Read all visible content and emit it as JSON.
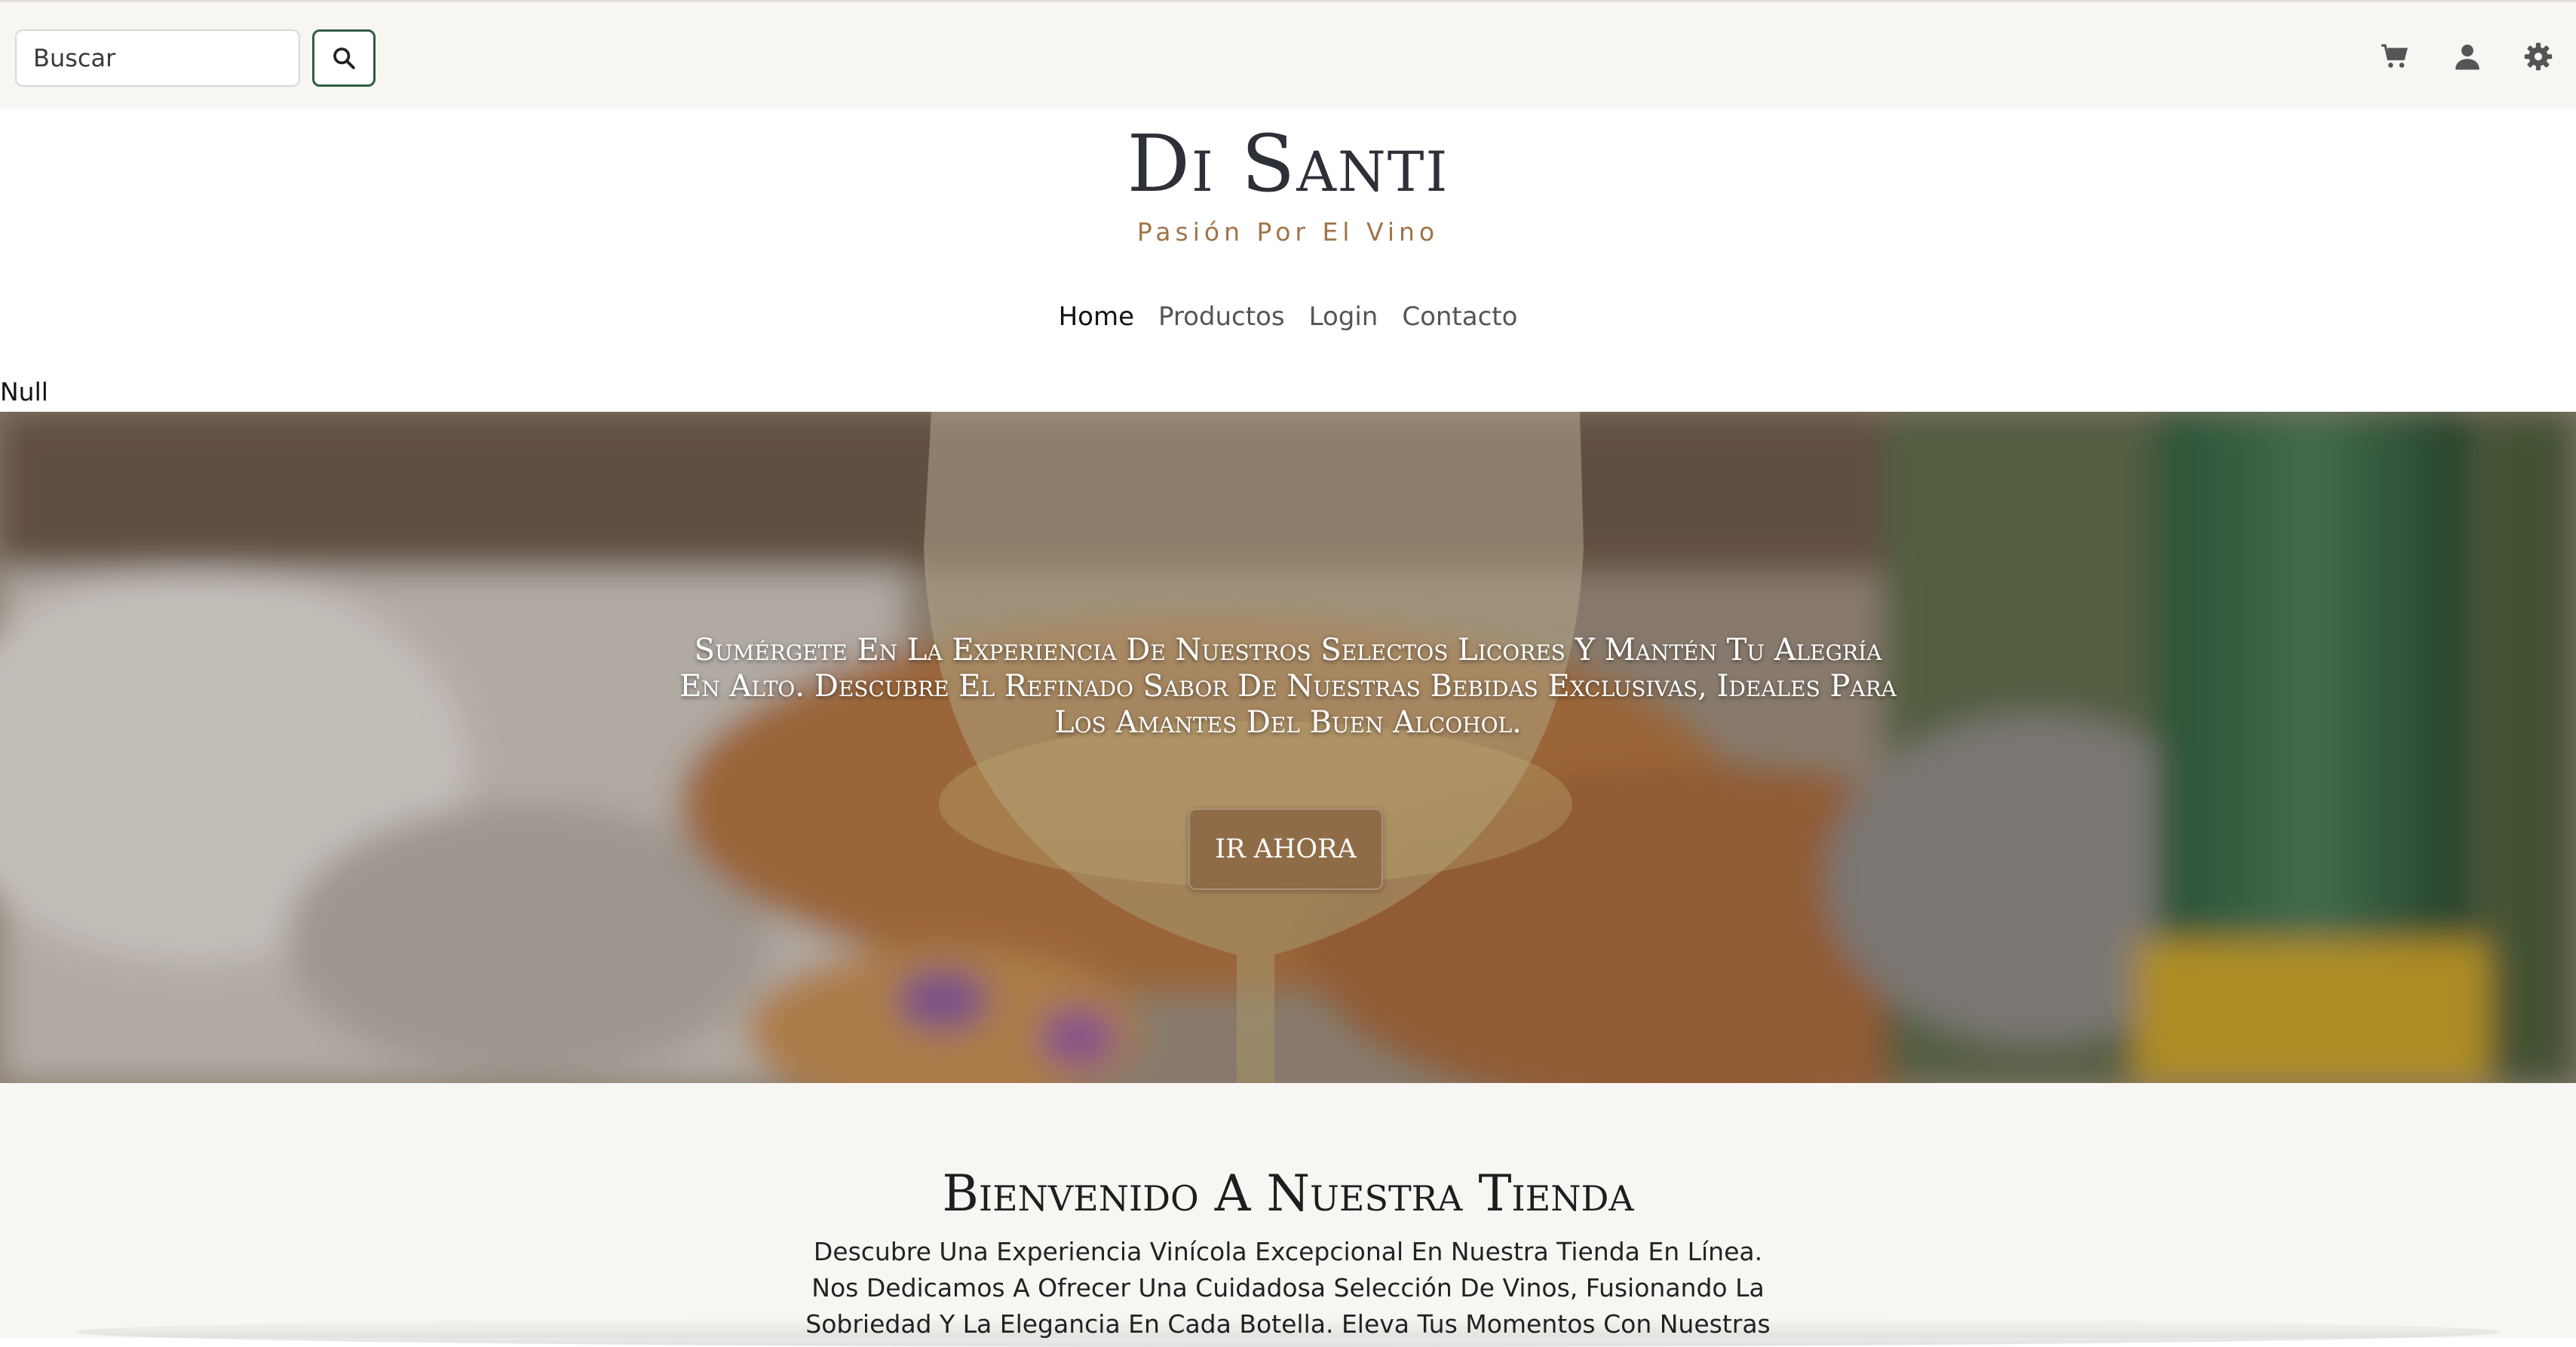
{
  "search": {
    "value": "Buscar",
    "icon": "search-icon"
  },
  "header_icons": [
    "cart-icon",
    "user-icon",
    "gear-icon"
  ],
  "brand": {
    "title": "Di Santi",
    "subtitle": "Pasión Por El Vino"
  },
  "nav": {
    "items": [
      "Home",
      "Productos",
      "Login",
      "Contacto"
    ],
    "active": "Home"
  },
  "null_text": "Null",
  "hero": {
    "text": "Sumérgete En La Experiencia De Nuestros Selectos Licores Y Mantén Tu Alegría En Alto. Descubre El Refinado Sabor De Nuestras Bebidas Exclusivas, Ideales Para Los Amantes Del Buen Alcohol.",
    "button_label": "IR AHORA"
  },
  "welcome": {
    "title": "Bienvenido A Nuestra Tienda",
    "text": "Descubre Una Experiencia Vinícola Excepcional En Nuestra Tienda En Línea. Nos Dedicamos A Ofrecer Una Cuidadosa Selección De Vinos, Fusionando La Sobriedad Y La Elegancia En Cada Botella. Eleva Tus Momentos Con Nuestras"
  },
  "colors": {
    "accent": "#2f5d46",
    "brand_subtitle": "#a07448",
    "hero_button": "#8b6744",
    "background": "#f8f6f3"
  }
}
